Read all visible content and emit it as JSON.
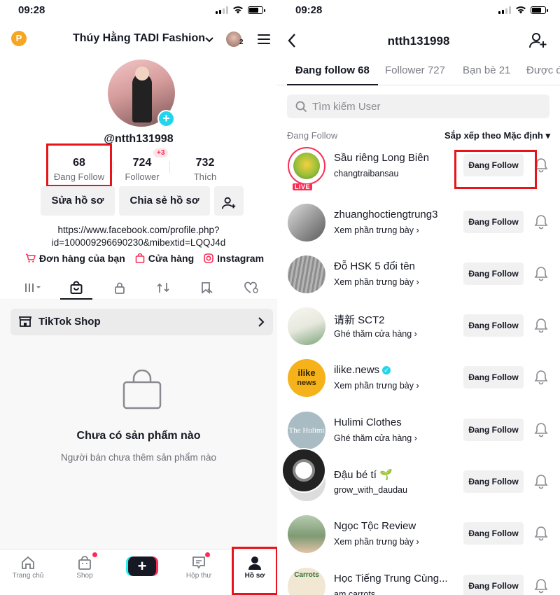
{
  "left": {
    "status": {
      "time": "09:28"
    },
    "header": {
      "p_badge": "P",
      "title": "Thúy Hằng TADI Fashion",
      "chevron": "⌄",
      "avatar_count": "2"
    },
    "profile": {
      "handle": "@ntth131998",
      "stats": [
        {
          "num": "68",
          "label": "Đang Follow"
        },
        {
          "num": "724",
          "label": "Follower",
          "badge": "+3"
        },
        {
          "num": "732",
          "label": "Thích"
        }
      ],
      "buttons": {
        "edit": "Sửa hồ sơ",
        "share": "Chia sẻ hồ sơ"
      },
      "link_line1": "https://www.facebook.com/profile.php?",
      "link_line2": "id=100009296690230&mibextid=LQQJ4d",
      "shortcuts": [
        "Đơn hàng của bạn",
        "Cửa hàng",
        "Instagram"
      ]
    },
    "shop": {
      "label": "TikTok Shop",
      "empty_title": "Chưa có sản phẩm nào",
      "empty_sub": "Người bán chưa thêm sản phẩm nào"
    },
    "nav": [
      "Trang chủ",
      "Shop",
      "Hộp thư",
      "Hồ sơ"
    ]
  },
  "right": {
    "status": {
      "time": "09:28"
    },
    "title": "ntth131998",
    "tabs": [
      "Đang follow 68",
      "Follower 727",
      "Bạn bè 21",
      "Được đ"
    ],
    "search_placeholder": "Tìm kiếm User",
    "list_label": "Đang Follow",
    "sort_label": "Sắp xếp theo Mặc định ▾",
    "follow_btn": "Đang Follow",
    "live_badge": "LIVE",
    "users": [
      {
        "name": "Sầu riêng Long Biên",
        "sub": "changtraibansau"
      },
      {
        "name": "zhuanghoctiengtrung3",
        "sub": "Xem phần trưng bày ›"
      },
      {
        "name": "Đỗ HSK 5 đổi tên",
        "sub": "Xem phần trưng bày ›"
      },
      {
        "name": "请新 SCT2",
        "sub": "Ghé thăm cửa hàng ›"
      },
      {
        "name": "ilike.news",
        "sub": "Xem phần trưng bày ›",
        "avatar_text1": "ilike",
        "avatar_text2": "news"
      },
      {
        "name": "Hulimi Clothes",
        "sub": "Ghé thăm cửa hàng ›",
        "avatar_text": "The Hulimi"
      },
      {
        "name": "Đậu bé tí 🌱",
        "sub": "grow_with_daudau"
      },
      {
        "name": "Ngọc Tộc Review",
        "sub": "Xem phần trưng bày ›"
      },
      {
        "name": "Học Tiếng Trung Cùng...",
        "sub": "am carrots",
        "avatar_text": "Carrots"
      }
    ]
  },
  "colors": {
    "accent": "#fe2c55",
    "cyan": "#20d5ec",
    "highlight_box": "#e8141c"
  }
}
